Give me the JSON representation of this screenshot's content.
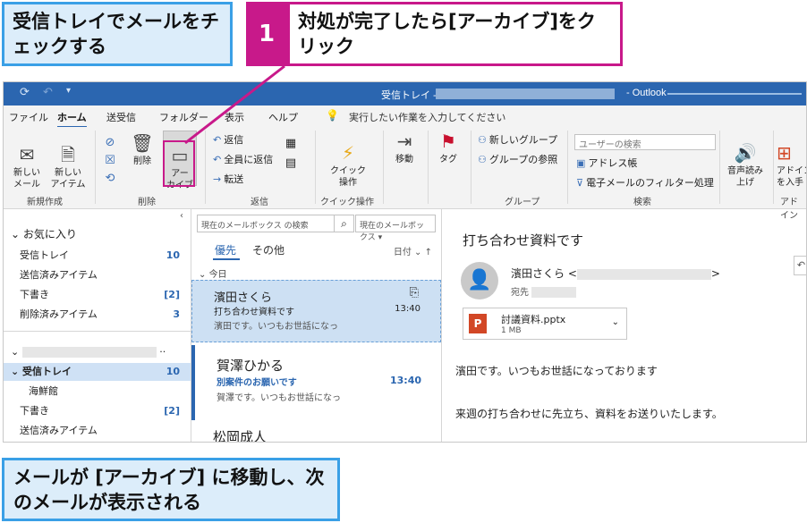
{
  "captions": {
    "top": "受信トレイでメールをチェックする",
    "step_number": "1",
    "step_text": "対処が完了したら[アーカイブ]をクリック",
    "bottom": "メールが [アーカイブ] に移動し、次のメールが表示される"
  },
  "window": {
    "title": "受信トレイ -",
    "app_name": "- Outlook"
  },
  "menu": {
    "tabs": [
      "ファイル",
      "ホーム",
      "送受信",
      "フォルダー",
      "表示",
      "ヘルプ"
    ],
    "active_tab": "ホーム",
    "tell_me": "実行したい作業を入力してください"
  },
  "ribbon": {
    "new_mail": "新しい\nメール",
    "new_items": "新しい\nアイテム",
    "delete": "削除",
    "archive": "アー\nカイブ",
    "reply": "返信",
    "reply_all": "全員に返信",
    "forward": "転送",
    "quick_steps": "クイック\n操作",
    "move": "移動",
    "tags": "タグ",
    "new_group": "新しいグループ",
    "browse_groups": "グループの参照",
    "search_people_placeholder": "ユーザーの検索",
    "address_book": "アドレス帳",
    "filter_email": "電子メールのフィルター処理",
    "read_aloud": "音声読み\n上げ",
    "addins": "アドイン\nを入手",
    "groups": {
      "new": "新規作成",
      "delete": "削除",
      "respond": "返信",
      "quick_steps": "クイック操作",
      "groups": "グループ",
      "find": "検索",
      "addins": "アドイン"
    }
  },
  "nav": {
    "favorites_header": "お気に入り",
    "favorites": [
      {
        "label": "受信トレイ",
        "count": "10"
      },
      {
        "label": "送信済みアイテム",
        "count": ""
      },
      {
        "label": "下書き",
        "count": "[2]"
      },
      {
        "label": "削除済みアイテム",
        "count": "3"
      }
    ],
    "account_items": [
      {
        "label": "受信トレイ",
        "count": "10"
      },
      {
        "label": "海鮮館",
        "count": ""
      },
      {
        "label": "下書き",
        "count": "[2]"
      },
      {
        "label": "送信済みアイテム",
        "count": ""
      }
    ]
  },
  "list": {
    "search_placeholder": "現在のメールボックス の検索",
    "scope": "現在のメールボックス",
    "tab_focused": "優先",
    "tab_other": "その他",
    "sort": "日付",
    "today_header": "今日",
    "mails": [
      {
        "from": "濱田さくら",
        "subject": "打ち合わせ資料です",
        "preview": "濱田です。いつもお世話になっ",
        "time": "13:40"
      },
      {
        "from": "賀澤ひかる",
        "subject": "別案件のお願いです",
        "preview": "賀澤です。いつもお世話になっ",
        "time": "13:40"
      },
      {
        "from": "松岡成人",
        "subject": "",
        "preview": "",
        "time": ""
      }
    ]
  },
  "reading": {
    "subject": "打ち合わせ資料です",
    "from": "濱田さくら <",
    "from_end": ">",
    "to_label": "宛先",
    "attachment_name": "討議資料.pptx",
    "attachment_size": "1 MB",
    "body_line1": "濱田です。いつもお世話になっております",
    "body_line2": "来週の打ち合わせに先立ち、資料をお送りいたします。"
  },
  "colors": {
    "callout_border": "#3aa0e6",
    "callout_fill": "#dcedfa",
    "step_accent": "#c8198a",
    "titlebar": "#2b66b0"
  }
}
